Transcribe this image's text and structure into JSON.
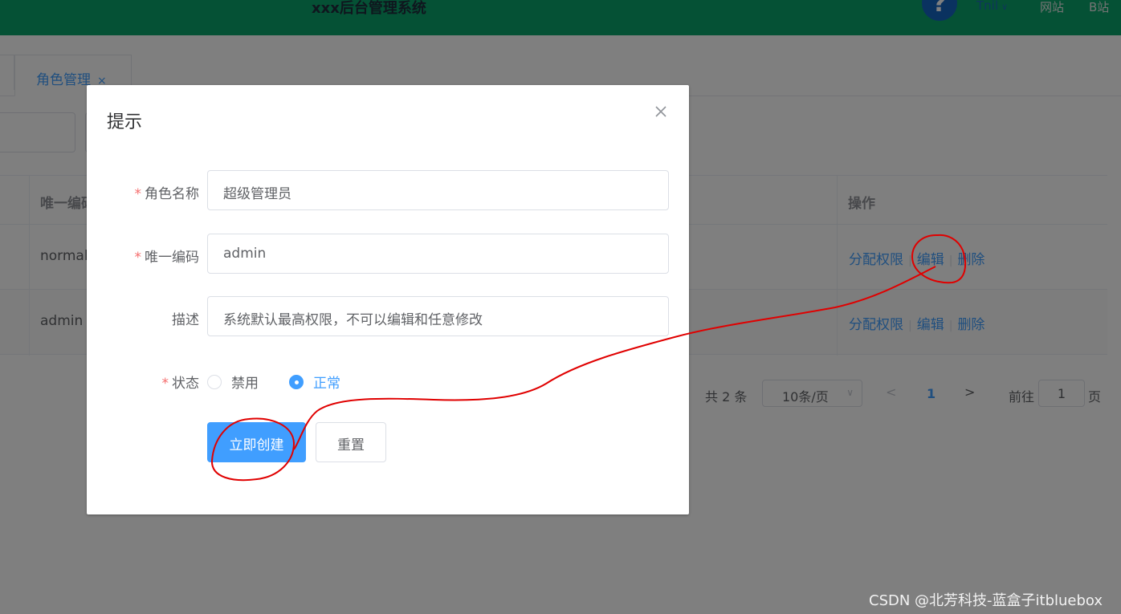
{
  "header": {
    "title": "xxx后台管理系统",
    "user_menu": "Tnil",
    "links": [
      "网站",
      "B站"
    ],
    "help_icon": "question-bulb-icon",
    "bg_color": "#0ba36a"
  },
  "tabs": [
    {
      "label": "角色管理",
      "active": true
    }
  ],
  "table": {
    "columns": [
      "唯一编码",
      "操作"
    ],
    "rows": [
      {
        "code": "normal",
        "actions": [
          "分配权限",
          "编辑",
          "删除"
        ]
      },
      {
        "code": "admin",
        "actions": [
          "分配权限",
          "编辑",
          "删除"
        ]
      }
    ]
  },
  "pagination": {
    "total_text": "共 2 条",
    "page_size": "10条/页",
    "current_page": "1",
    "goto_label": "前往",
    "goto_value": "1",
    "goto_unit": "页"
  },
  "dialog": {
    "title": "提示",
    "fields": {
      "role_name": {
        "label": "角色名称",
        "value": "超级管理员",
        "required": true
      },
      "code": {
        "label": "唯一编码",
        "value": "admin",
        "required": true
      },
      "description": {
        "label": "描述",
        "value": "系统默认最高权限，不可以编辑和任意修改",
        "required": false
      }
    },
    "status": {
      "label": "状态",
      "required": true,
      "options": [
        "禁用",
        "正常"
      ],
      "selected": "正常"
    },
    "submit_label": "立即创建",
    "reset_label": "重置"
  },
  "watermark": "CSDN @北芳科技-蓝盒子itbluebox",
  "colors": {
    "primary": "#409eff",
    "required": "#f56c6c",
    "annotation": "#e00000"
  }
}
